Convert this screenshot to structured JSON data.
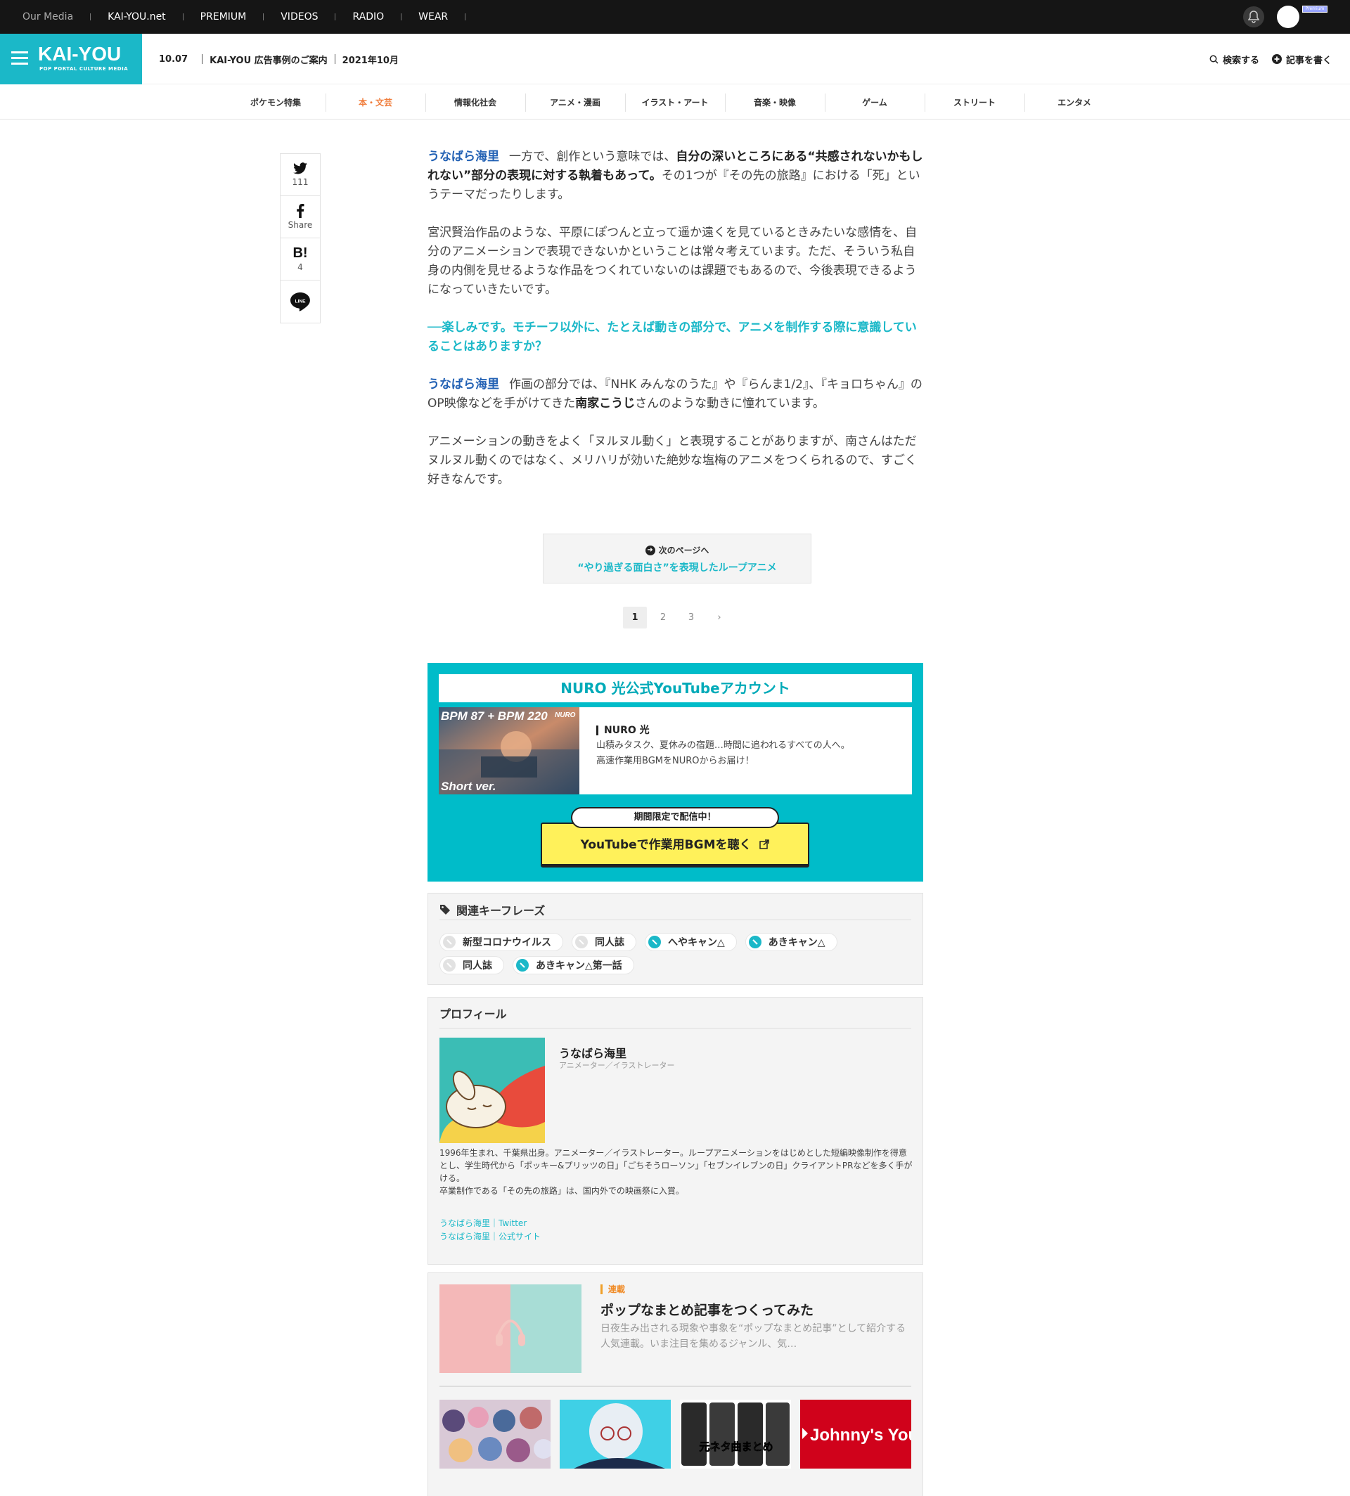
{
  "topbar": {
    "media_items": [
      "Our Media",
      "KAI-YOU.net",
      "PREMIUM",
      "VIDEOS",
      "RADIO",
      "WEAR"
    ],
    "premium_badge": "Premium"
  },
  "header": {
    "logo": "KAI-YOU",
    "tagline": "POP PORTAL CULTURE MEDIA",
    "date": "10.07",
    "headline": "KAI-YOU 広告事例のご案内",
    "month": "2021年10月",
    "search": "検索する",
    "write": "記事を書く"
  },
  "categories": [
    "ポケモン特集",
    "本・文芸",
    "情報化社会",
    "アニメ・漫画",
    "イラスト・アート",
    "音楽・映像",
    "ゲーム",
    "ストリート",
    "エンタメ"
  ],
  "active_category": "本・文芸",
  "share": {
    "twitter_count": "111",
    "facebook_label": "Share",
    "hatena_label": "B!",
    "hatena_count": "4",
    "line_label": "LINE"
  },
  "article": {
    "p1": {
      "speaker": "うなばら海里",
      "t1": "一方で、創作という意味では、",
      "b1": "自分の深いところにある“共感されないかもしれない”部分の表現に対する執着もあって。",
      "t2": "その1つが『その先の旅路』における「死」というテーマだったりします。"
    },
    "p2": "宮沢賢治作品のような、平原にぽつんと立って遥か遠くを見ているときみたいな感情を、自分のアニメーションで表現できないかということは常々考えています。ただ、そういう私自身の内側を見せるような作品をつくれていないのは課題でもあるので、今後表現できるようになっていきたいです。",
    "question": "──楽しみです。モチーフ以外に、たとえば動きの部分で、アニメを制作する際に意識していることはありますか？",
    "p3": {
      "speaker": "うなばら海里",
      "t1": "作画の部分では、『NHK みんなのうた』や『らんま1/2』、『キョロちゃん』のOP映像などを手がけてきた",
      "b1": "南家こうじ",
      "t2": "さんのような動きに憧れています。"
    },
    "p4": "アニメーションの動きをよく「ヌルヌル動く」と表現することがありますが、南さんはただヌルヌル動くのではなく、メリハリが効いた絶妙な塩梅のアニメをつくられるので、すごく好きなんです。"
  },
  "next_page": {
    "label": "次のページへ",
    "title": "“やり過ぎる面白さ”を表現したループアニメ"
  },
  "pagination": [
    "1",
    "2",
    "3",
    "›"
  ],
  "nuro": {
    "title": "NURO 光公式YouTubeアカウント",
    "thumb_text1": "BPM 87 + BPM 220",
    "thumb_logo": "NURO",
    "thumb_text2": "Short ver.",
    "brand": "NURO 光",
    "desc1": "山積みタスク、夏休みの宿題…時間に追われるすべての人へ。",
    "desc2": "高速作業用BGMをNUROからお届け！",
    "bubble": "期間限定で配信中！",
    "button": "YouTubeで作業用BGMを聴く"
  },
  "keyphrases": {
    "title": "関連キーフレーズ",
    "tags": [
      {
        "label": "新型コロナウイルス",
        "style": "grey"
      },
      {
        "label": "同人誌",
        "style": "grey"
      },
      {
        "label": "へやキャン△",
        "style": "blue"
      },
      {
        "label": "あきキャン△",
        "style": "blue"
      },
      {
        "label": "同人誌",
        "style": "grey"
      },
      {
        "label": "あきキャン△第一話",
        "style": "blue"
      }
    ]
  },
  "profile": {
    "title": "プロフィール",
    "name": "うなばら海里",
    "role": "アニメーター／イラストレーター",
    "bio1": "1996年生まれ、千葉県出身。アニメーター／イラストレーター。ループアニメーションをはじめとした短編映像制作を得意とし、学生時代から「ポッキー&プリッツの日」「ごちそうローソン」「セブンイレブンの日」クライアントPRなどを多く手がける。",
    "bio2": "卒業制作である「その先の旅路」は、国内外での映画祭に入賞。",
    "link1": "うなばら海里｜Twitter",
    "link2": "うなばら海里｜公式サイト"
  },
  "series": {
    "tag": "連載",
    "title": "ポップなまとめ記事をつくってみた",
    "desc": "日夜生み出される現象や事象を“ポップなまとめ記事”として紹介する人気連載。いま注目を集めるジャンル、気…",
    "thumb3_text": "元ネタ曲まとめ",
    "thumb4_text": "Johnny's YouTu"
  },
  "colors": {
    "brand": "#1bb8c8",
    "active_category": "#f07d3c",
    "speaker": "#2261b4",
    "nuro_bg": "#00bcc9",
    "yt_button": "#fff15a"
  }
}
